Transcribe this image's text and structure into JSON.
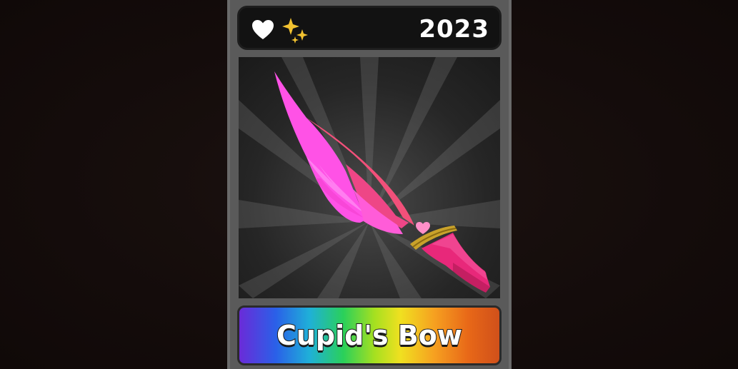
{
  "card": {
    "year": "2023",
    "item_name": "Cupid's Bow",
    "icons": [
      "heart-icon",
      "sparkle-icon"
    ],
    "rarity": "chroma"
  },
  "colors": {
    "heart": "#ffffff",
    "sparkle": "#f2c230",
    "blade_main": "#ff4fe0",
    "blade_edge": "#f04a78",
    "guard": "#c9a22a",
    "handle": "#e8287a"
  }
}
